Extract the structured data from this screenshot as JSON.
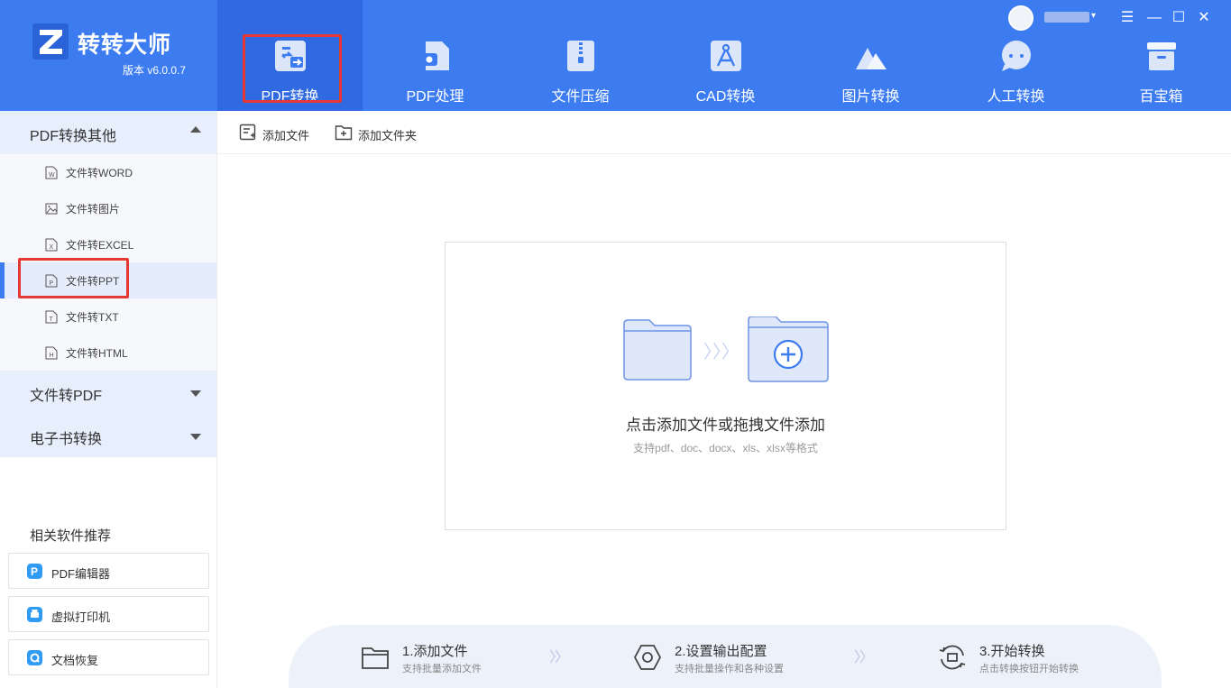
{
  "app": {
    "name": "转转大师",
    "version": "版本 v6.0.0.7"
  },
  "colors": {
    "header_bg": "#3d7cf0",
    "nav_active_bg": "#2f6ae3",
    "highlight_box": "#e53935",
    "sidebar_group_bg": "#e7eefc",
    "sidebar_active_bg": "#e5edfc"
  },
  "nav": {
    "items": [
      {
        "label": "PDF转换",
        "icon": "pdf-convert-icon",
        "active": true
      },
      {
        "label": "PDF处理",
        "icon": "pdf-process-icon"
      },
      {
        "label": "文件压缩",
        "icon": "zip-icon"
      },
      {
        "label": "CAD转换",
        "icon": "cad-icon"
      },
      {
        "label": "图片转换",
        "icon": "image-mountain-icon"
      },
      {
        "label": "人工转换",
        "icon": "chat-bubble-icon"
      },
      {
        "label": "百宝箱",
        "icon": "toolbox-icon"
      }
    ]
  },
  "window": {
    "menu": "☰",
    "minimize": "—",
    "maximize": "☐",
    "close": "✕",
    "user_caret": "▾"
  },
  "sidebar": {
    "groups": [
      {
        "label": "PDF转换其他",
        "expanded": true
      },
      {
        "label": "文件转PDF",
        "expanded": false
      },
      {
        "label": "电子书转换",
        "expanded": false
      }
    ],
    "sub_items": [
      {
        "label": "文件转WORD",
        "icon": "word-file-icon",
        "glyph": "W"
      },
      {
        "label": "文件转图片",
        "icon": "picture-icon",
        "glyph": ""
      },
      {
        "label": "文件转EXCEL",
        "icon": "excel-file-icon",
        "glyph": "X"
      },
      {
        "label": "文件转PPT",
        "icon": "ppt-file-icon",
        "glyph": "P",
        "active": true
      },
      {
        "label": "文件转TXT",
        "icon": "txt-file-icon",
        "glyph": "T"
      },
      {
        "label": "文件转HTML",
        "icon": "html-file-icon",
        "glyph": "H"
      }
    ],
    "recommend_title": "相关软件推荐",
    "recommend": [
      {
        "label": "PDF编辑器",
        "icon": "pdf-editor-icon",
        "color": "#2f9bf5"
      },
      {
        "label": "虚拟打印机",
        "icon": "virtual-printer-icon",
        "color": "#2f9bf5"
      },
      {
        "label": "文档恢复",
        "icon": "doc-recovery-icon",
        "color": "#2f9bf5"
      }
    ]
  },
  "toolbar": {
    "add_file": "添加文件",
    "add_folder": "添加文件夹"
  },
  "dropzone": {
    "title": "点击添加文件或拖拽文件添加",
    "subtitle": "支持pdf、doc、docx、xls、xlsx等格式",
    "arrows": "〉〉〉"
  },
  "steps": [
    {
      "title": "1.添加文件",
      "sub": "支持批量添加文件",
      "icon": "folder-icon"
    },
    {
      "title": "2.设置输出配置",
      "sub": "支持批量操作和各种设置",
      "icon": "settings-hex-icon"
    },
    {
      "title": "3.开始转换",
      "sub": "点击转换按钮开始转换",
      "icon": "convert-icon"
    }
  ],
  "step_arrow": "〉〉"
}
